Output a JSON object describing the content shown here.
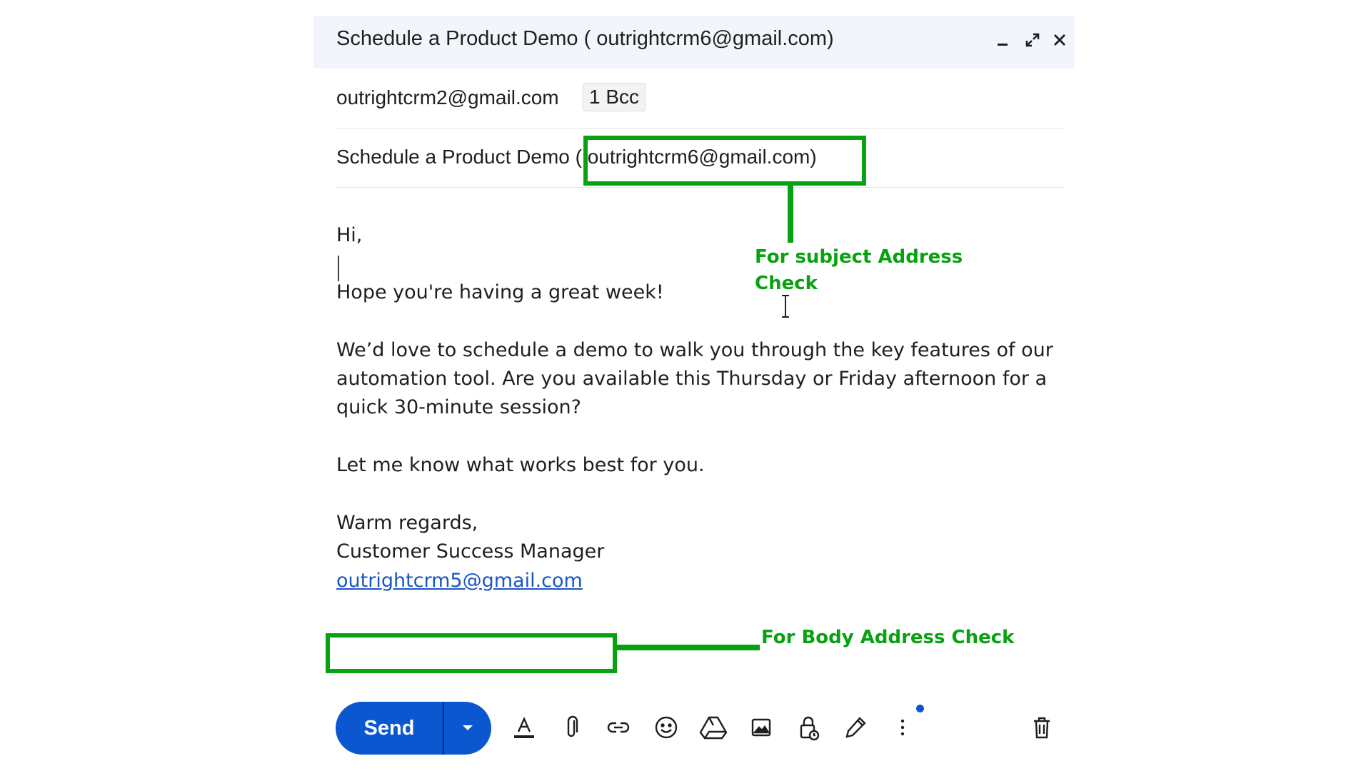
{
  "compose": {
    "title": "Schedule a Product Demo ( outrightcrm6@gmail.com)",
    "to": "outrightcrm2@gmail.com",
    "bcc_chip": "1 Bcc",
    "subject": "Schedule a Product Demo ( outrightcrm6@gmail.com)",
    "header_icons": [
      "minimize-icon",
      "expand-icon",
      "close-icon"
    ]
  },
  "body": {
    "greeting": "Hi,",
    "line1": "Hope you're having a great week!",
    "para1": [
      "We’d love to schedule a demo to walk you through the key features of our",
      "automation tool. Are you available this Thursday or Friday afternoon for a",
      "quick 30-minute session?"
    ],
    "line2": "Let me know what works best for you.",
    "signoff": "Warm regards,",
    "signature_title": "Customer Success Manager",
    "signature_email": "outrightcrm5@gmail.com"
  },
  "annotations": {
    "subject_check": [
      "For subject Address",
      "Check"
    ],
    "body_check": "For Body Address Check",
    "color": "#07a20f"
  },
  "toolbar": {
    "send_label": "Send",
    "send_color": "#0b57d0",
    "icons": [
      "text-format-icon",
      "attach-icon",
      "link-icon",
      "emoji-icon",
      "drive-icon",
      "photo-icon",
      "confidential-mode-icon",
      "signature-icon",
      "more-options-icon",
      "discard-icon"
    ]
  }
}
